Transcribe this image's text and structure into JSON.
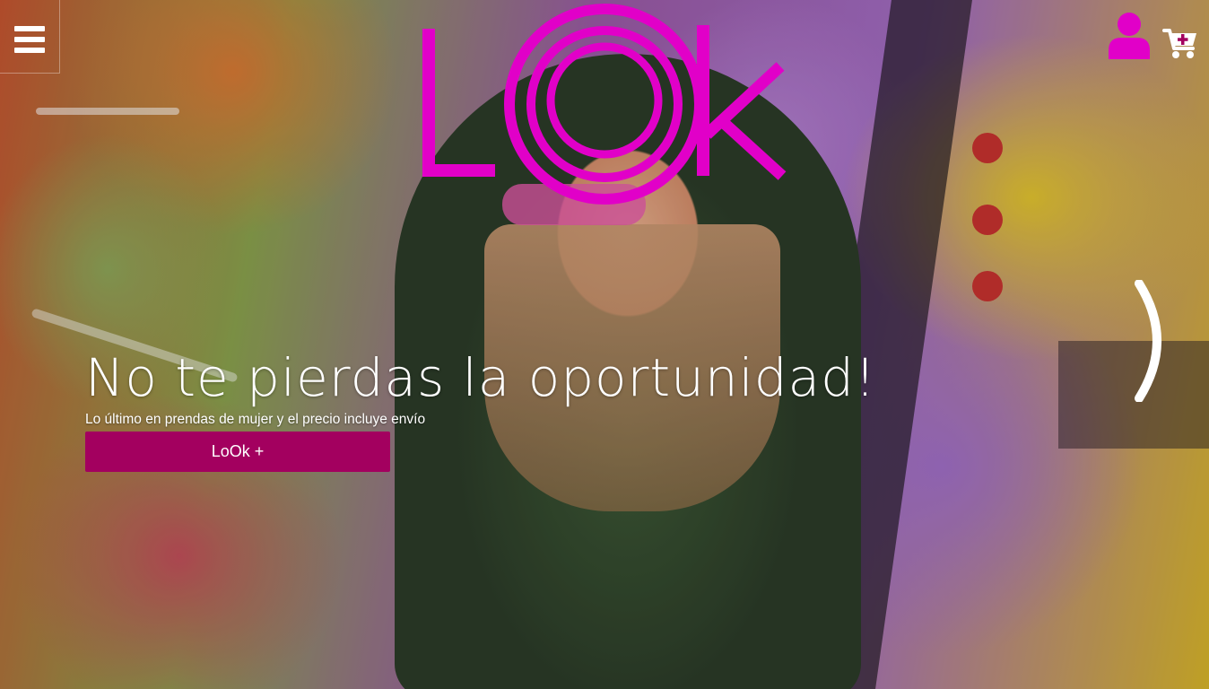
{
  "brand": {
    "logo_text": "LOOk",
    "accent_color": "#e100c8"
  },
  "header": {
    "menu_icon": "hamburger-menu-icon",
    "user_icon": "user-icon",
    "cart_icon": "cart-plus-icon"
  },
  "hero": {
    "headline": "No te pierdas la oportunidad!",
    "subline": "Lo último en prendas de mujer y el precio incluye envío",
    "cta_label": "LoOk +",
    "cta_color": "#a3005f",
    "next_icon": "chevron-right-icon"
  }
}
